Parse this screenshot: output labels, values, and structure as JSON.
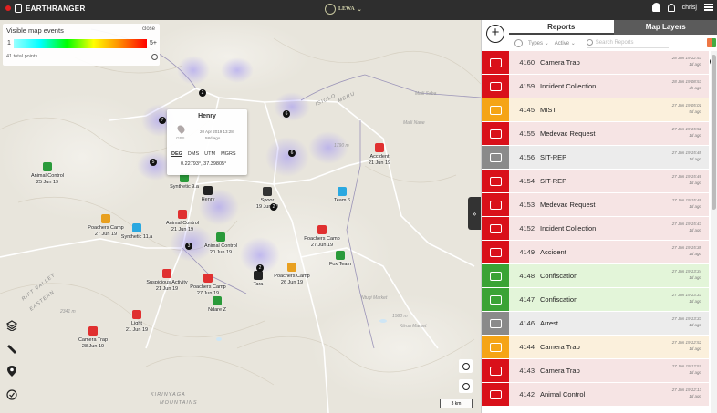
{
  "app": {
    "name": "EARTHRANGER",
    "org": "LEWA",
    "user": "chrisj"
  },
  "legend": {
    "title": "Visible map events",
    "close": "close",
    "min": "1",
    "max": "5+",
    "total": "41 total points"
  },
  "popup": {
    "title": "Henry",
    "date": "20 Apr 2019 13:28",
    "ago": "58d ago",
    "gps": "GPS",
    "formats": [
      "DEG",
      "DMS",
      "UTM",
      "MGRS"
    ],
    "coords": "0.22793°, 37.39805°"
  },
  "geo": [
    {
      "t": "RIFT VALLEY",
      "cls": ""
    },
    {
      "t": "EASTERN",
      "cls": ""
    },
    {
      "t": "ISIOLO",
      "cls": ""
    },
    {
      "t": "MERU",
      "cls": ""
    },
    {
      "t": "Maili Saba",
      "cls": "small"
    },
    {
      "t": "Maili Nane",
      "cls": "small"
    },
    {
      "t": "Ntugi Market",
      "cls": "small"
    },
    {
      "t": "Kiirua Market",
      "cls": "small"
    },
    {
      "t": "KIRINYAGA",
      "cls": ""
    },
    {
      "t": "MOUNTAINS",
      "cls": ""
    },
    {
      "t": "2341 m",
      "cls": "small"
    },
    {
      "t": "1790 m",
      "cls": "small"
    },
    {
      "t": "1580 m",
      "cls": "small"
    }
  ],
  "markers": [
    {
      "label": "Animal Control",
      "date": "25 Jun 19",
      "color": "#2a9a3a"
    },
    {
      "label": "Poachers Camp",
      "date": "27 Jun 19",
      "color": "#e8a020"
    },
    {
      "label": "Synthetic 11.a",
      "date": "",
      "color": "#2aa8e0"
    },
    {
      "label": "Animal Control",
      "date": "21 Jun 19",
      "color": "#e03030"
    },
    {
      "label": "Animal Control",
      "date": "20 Jun 19",
      "color": "#2a9a3a"
    },
    {
      "label": "Synthetic 9.a",
      "date": "",
      "color": "#2a9a3a"
    },
    {
      "label": "Henry",
      "date": "",
      "color": "#222"
    },
    {
      "label": "Spoor",
      "date": "19 Jun 19",
      "color": "#333"
    },
    {
      "label": "Team 6",
      "date": "",
      "color": "#2aa8e0"
    },
    {
      "label": "Poachers Camp",
      "date": "27 Jun 19",
      "color": "#e03030"
    },
    {
      "label": "Fox Team",
      "date": "",
      "color": "#2a9a3a"
    },
    {
      "label": "Accident",
      "date": "21 Jun 19",
      "color": "#e03030"
    },
    {
      "label": "Poachers Camp",
      "date": "26 Jun 19",
      "color": "#e8a020"
    },
    {
      "label": "Tara",
      "date": "",
      "color": "#222"
    },
    {
      "label": "Poachers Camp",
      "date": "27 Jun 19",
      "color": "#e03030"
    },
    {
      "label": "Suspicious Activity",
      "date": "21 Jun 19",
      "color": "#e03030"
    },
    {
      "label": "Ndare Z",
      "date": "",
      "color": "#2a9a3a"
    },
    {
      "label": "Light",
      "date": "21 Jun 19",
      "color": "#e03030"
    },
    {
      "label": "Camera Trap",
      "date": "28 Jun 19",
      "color": "#e03030"
    }
  ],
  "clusters": [
    "2",
    "7",
    "5",
    "6",
    "6",
    "3",
    "2",
    "2"
  ],
  "scale": "3 km",
  "panel": {
    "tabs": [
      "Reports",
      "Map Layers"
    ],
    "filters": {
      "types": "Types",
      "active": "Active",
      "search_placeholder": "Search Reports"
    },
    "reports": [
      {
        "id": "4160",
        "title": "Camera Trap",
        "date": "28 Jun 19 12:53",
        "ago": "1d ago",
        "color": "#d9101a",
        "bg": "#f6e4e4"
      },
      {
        "id": "4159",
        "title": "Incident Collection",
        "date": "28 Jun 19 08:53",
        "ago": "4h ago",
        "color": "#d9101a",
        "bg": "#f6e4e4"
      },
      {
        "id": "4145",
        "title": "MIST",
        "date": "27 Jun 19 05:01",
        "ago": "5d ago",
        "color": "#f5a416",
        "bg": "#fbf0dc"
      },
      {
        "id": "4155",
        "title": "Medevac Request",
        "date": "27 Jun 19 15:52",
        "ago": "1d ago",
        "color": "#d9101a",
        "bg": "#f6e4e4"
      },
      {
        "id": "4156",
        "title": "SIT-REP",
        "date": "27 Jun 19 15:48",
        "ago": "1d ago",
        "color": "#8a8a8a",
        "bg": "#ececec"
      },
      {
        "id": "4154",
        "title": "SIT-REP",
        "date": "27 Jun 19 15:46",
        "ago": "1d ago",
        "color": "#d9101a",
        "bg": "#f6e4e4"
      },
      {
        "id": "4153",
        "title": "Medevac Request",
        "date": "27 Jun 19 15:46",
        "ago": "1d ago",
        "color": "#d9101a",
        "bg": "#f6e4e4"
      },
      {
        "id": "4152",
        "title": "Incident Collection",
        "date": "27 Jun 19 15:43",
        "ago": "1d ago",
        "color": "#d9101a",
        "bg": "#f6e4e4"
      },
      {
        "id": "4149",
        "title": "Accident",
        "date": "27 Jun 19 15:38",
        "ago": "1d ago",
        "color": "#d9101a",
        "bg": "#f6e4e4"
      },
      {
        "id": "4148",
        "title": "Confiscation",
        "date": "27 Jun 19 13:34",
        "ago": "1d ago",
        "color": "#3aa335",
        "bg": "#e3f5d9"
      },
      {
        "id": "4147",
        "title": "Confiscation",
        "date": "27 Jun 19 13:33",
        "ago": "1d ago",
        "color": "#3aa335",
        "bg": "#e3f5d9"
      },
      {
        "id": "4146",
        "title": "Arrest",
        "date": "27 Jun 19 13:33",
        "ago": "1d ago",
        "color": "#8a8a8a",
        "bg": "#ececec"
      },
      {
        "id": "4144",
        "title": "Camera Trap",
        "date": "27 Jun 19 12:52",
        "ago": "1d ago",
        "color": "#f5a416",
        "bg": "#fbf0dc"
      },
      {
        "id": "4143",
        "title": "Camera Trap",
        "date": "27 Jun 19 12:51",
        "ago": "1d ago",
        "color": "#d9101a",
        "bg": "#f6e4e4"
      },
      {
        "id": "4142",
        "title": "Animal Control",
        "date": "27 Jun 19 12:13",
        "ago": "1d ago",
        "color": "#d9101a",
        "bg": "#f6e4e4"
      }
    ]
  }
}
